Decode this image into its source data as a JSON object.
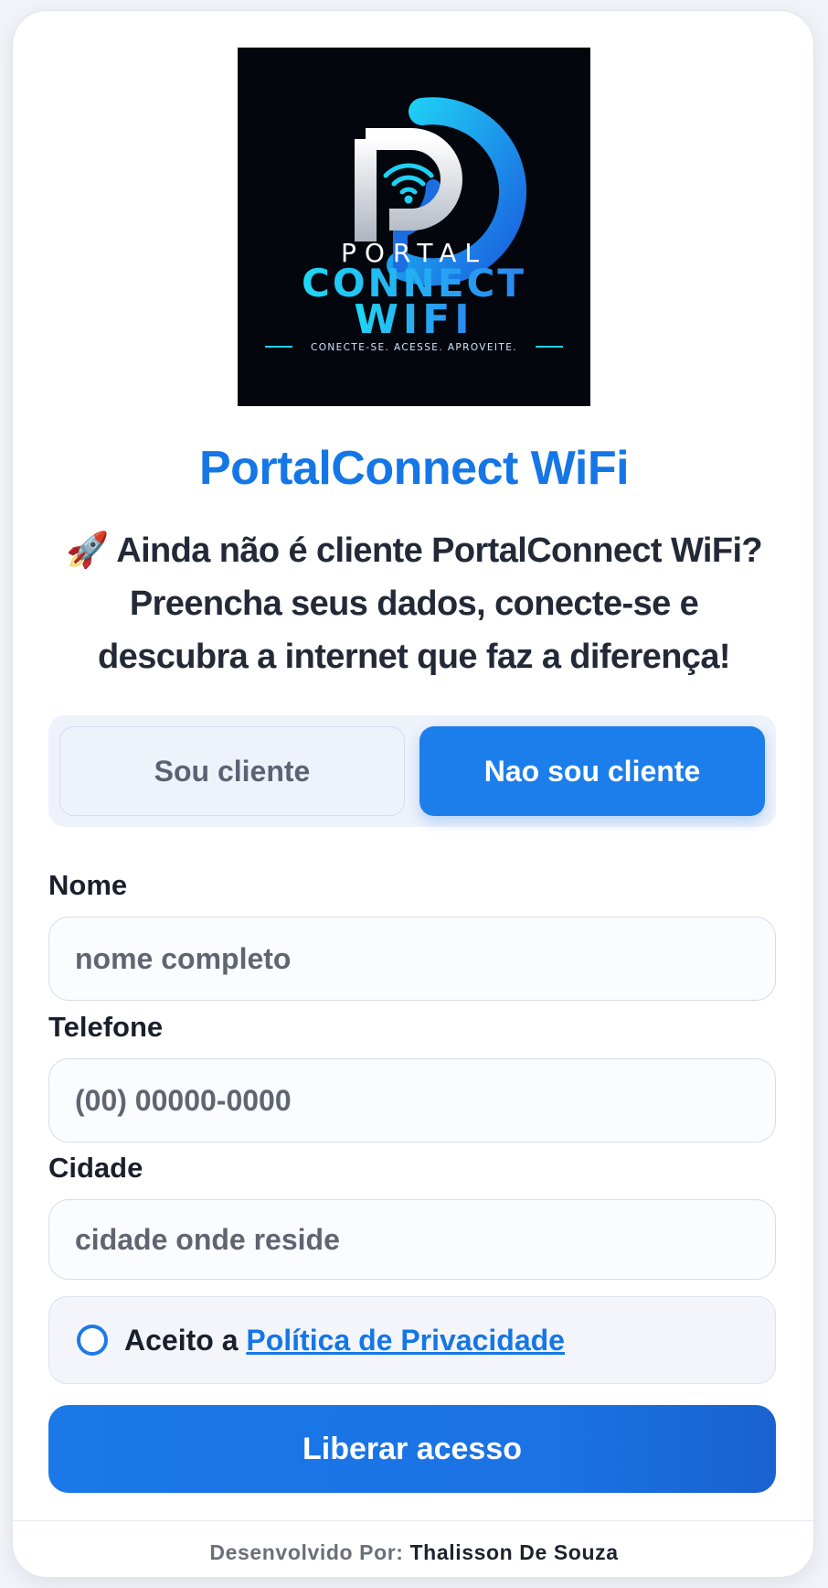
{
  "brand": {
    "logo_word1": "PORTAL",
    "logo_word2": "CONNECT",
    "logo_word3": "WIFI",
    "logo_tagline": "CONECTE-SE. ACESSE. APROVEITE.",
    "title": "PortalConnect WiFi"
  },
  "intro": {
    "icon": "rocket-icon",
    "emoji": "🚀",
    "line1": " Ainda não é cliente PortalConnect WiFi?",
    "line2": "Preencha seus dados, conecte-se e",
    "line3": "descubra a internet que faz a diferença!"
  },
  "toggle": {
    "client_label": "Sou cliente",
    "nonclient_label": "Nao sou cliente",
    "selected": "nonclient"
  },
  "form": {
    "name_label": "Nome",
    "name_placeholder": "nome completo",
    "phone_label": "Telefone",
    "phone_placeholder": "(00) 00000-0000",
    "city_label": "Cidade",
    "city_placeholder": "cidade onde reside",
    "consent_prefix": "Aceito a ",
    "consent_link": "Política de Privacidade",
    "submit_label": "Liberar acesso"
  },
  "footer": {
    "prefix": "Desenvolvido Por: ",
    "author": "Thalisson De Souza"
  },
  "colors": {
    "accent": "#1576e6",
    "button": "#1c7eea",
    "logo_cyan": "#1fd0f2",
    "logo_bg": "#03060d"
  }
}
